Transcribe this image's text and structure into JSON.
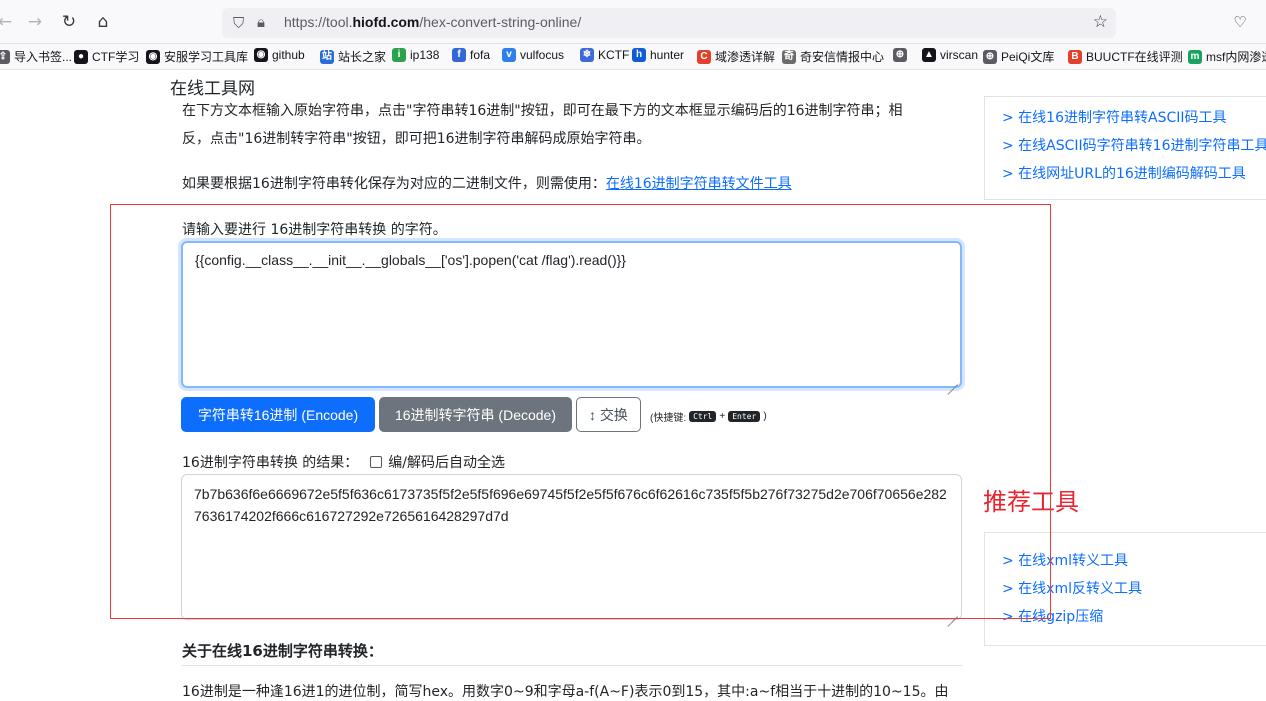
{
  "browser": {
    "url_prefix": "https://tool.",
    "url_domain": "hiofd.com",
    "url_path": "/hex-convert-string-online/",
    "bookmarks": [
      {
        "label": "导入书签...",
        "color": "#5b5b66",
        "icon": "import-icon"
      },
      {
        "label": "CTF学习",
        "color": "#15141a",
        "icon": "ctf-icon"
      },
      {
        "label": "安服学习工具库",
        "color": "#15141a",
        "icon": "github-icon"
      },
      {
        "label": "github",
        "color": "#15141a",
        "icon": "github-icon"
      },
      {
        "label": "站长之家",
        "color": "#2a6dd6",
        "icon": "chinaz-icon"
      },
      {
        "label": "ip138",
        "color": "#2ca24c",
        "icon": "ip138-icon"
      },
      {
        "label": "fofa",
        "color": "#3367d6",
        "icon": "fofa-icon"
      },
      {
        "label": "vulfocus",
        "color": "#2f80ed",
        "icon": "vulfocus-icon"
      },
      {
        "label": "KCTF",
        "color": "#3d6ad6",
        "icon": "kctf-icon"
      },
      {
        "label": "hunter",
        "color": "#0f5ed7",
        "icon": "hunter-icon"
      },
      {
        "label": "域渗透详解",
        "color": "#e3412c",
        "icon": "csdn-icon"
      },
      {
        "label": "奇安信情报中心",
        "color": "#6b6b6b",
        "icon": "qianxin-icon"
      },
      {
        "label": "",
        "color": "#5b5b66",
        "icon": "globe-icon"
      },
      {
        "label": "virscan",
        "color": "#15141a",
        "icon": "virscan-icon"
      },
      {
        "label": "PeiQi文库",
        "color": "#5b5b66",
        "icon": "globe-icon"
      },
      {
        "label": "BUUCTF在线评测",
        "color": "#e3412c",
        "icon": "buuctf-icon"
      },
      {
        "label": "msf内网渗透",
        "color": "#1aa260",
        "icon": "msf-icon"
      }
    ]
  },
  "page": {
    "site_title": "在线工具网",
    "intro_line1": "在下方文本框输入原始字符串，点击\"字符串转16进制\"按钮，即可在最下方的文本框显示编码后的16进制字符串；相",
    "intro_line2": "反，点击\"16进制转字符串\"按钮，即可把16进制字符串解码成原始字符串。",
    "intro_line3_prefix": "如果要根据16进制字符串转化保存为对应的二进制文件，则需使用：",
    "intro_line3_link": "在线16进制字符串转文件工具",
    "input_label": "请输入要进行 16进制字符串转换 的字符。",
    "input_value": "{{config.__class__.__init__.__globals__['os'].popen('cat /flag').read()}}",
    "encode_button": "字符串转16进制 (Encode)",
    "decode_button": "16进制转字符串 (Decode)",
    "swap_button": "↕ 交换",
    "shortcut_prefix": "(快捷键:",
    "shortcut_key1": "Ctrl",
    "shortcut_plus": "+",
    "shortcut_key2": "Enter",
    "shortcut_suffix": ")",
    "result_label": "16进制字符串转换 的结果：",
    "auto_select_label": "编/解码后自动全选",
    "output_value": "7b7b636f6e6669672e5f5f636c6173735f5f2e5f5f696e69745f5f2e5f5f676c6f62616c735f5f5b276f73275d2e706f70656e2827636174202f666c616727292e7265616428297d7d",
    "about_title": "关于在线16进制字符串转换：",
    "about_text": "16进制是一种逢16进1的进位制，简写hex。用数字0~9和字母a-f(A~F)表示0到15，其中:a~f相当于十进制的10~15。由"
  },
  "sidebar": {
    "top_links": [
      "> 在线16进制字符串转ASCII码工具",
      "> 在线ASCII码字符串转16进制字符串工具",
      "> 在线网址URL的16进制编码解码工具"
    ],
    "recommend_title": "推荐工具",
    "bottom_links": [
      "> 在线xml转义工具",
      "> 在线xml反转义工具",
      "> 在线gzip压缩"
    ]
  }
}
